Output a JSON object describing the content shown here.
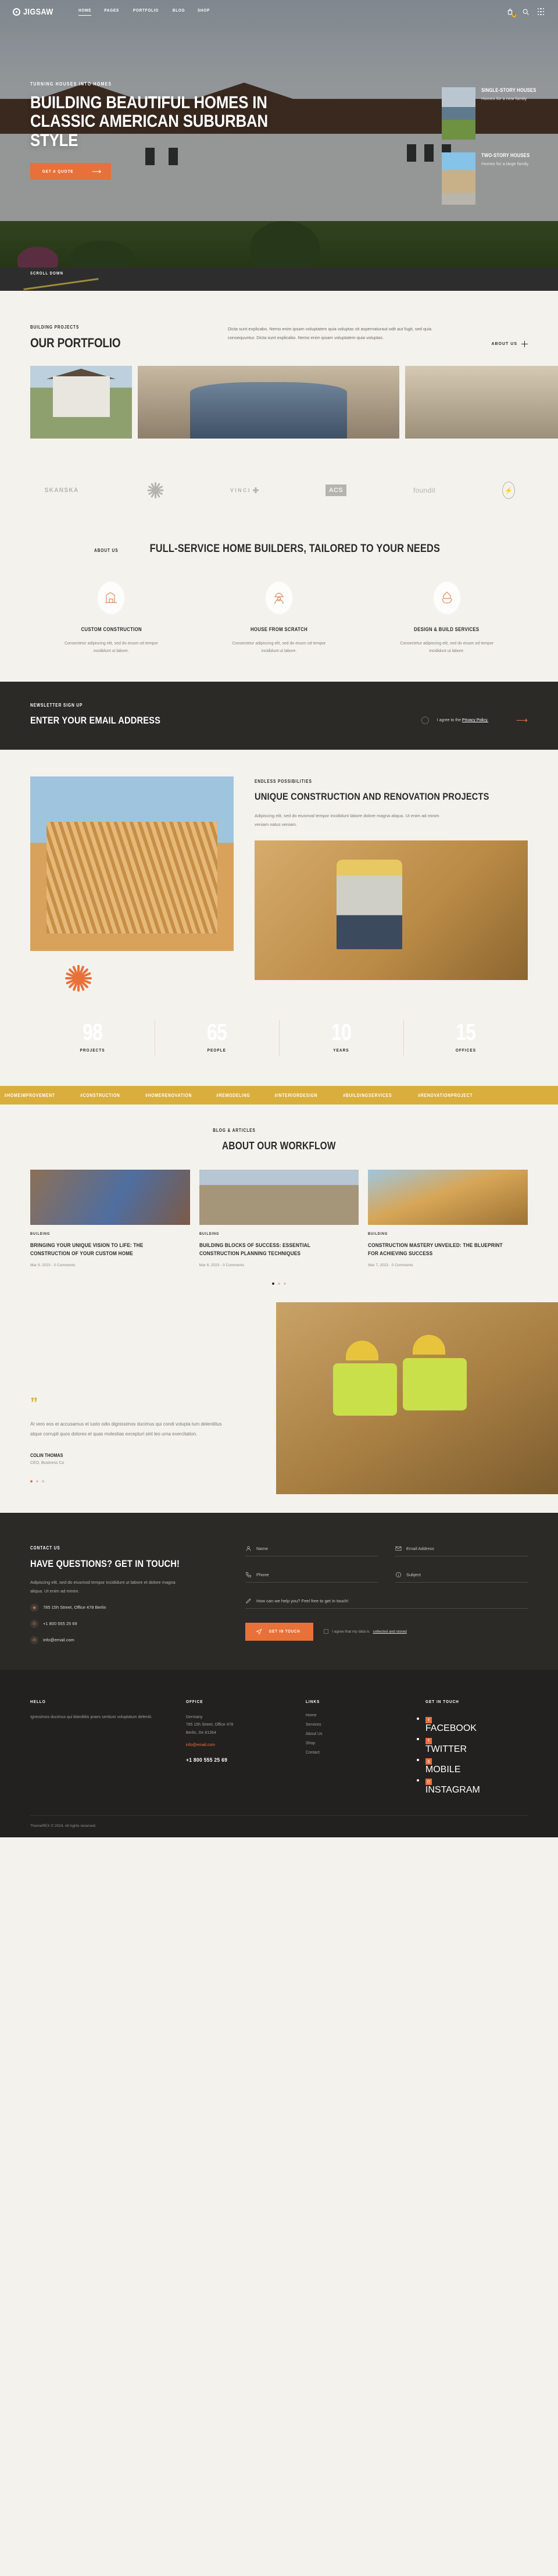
{
  "header": {
    "brand": "JIGSAW",
    "menu": [
      {
        "label": "HOME",
        "active": true
      },
      {
        "label": "PAGES",
        "active": false
      },
      {
        "label": "PORTFOLIO",
        "active": false
      },
      {
        "label": "BLOG",
        "active": false
      },
      {
        "label": "SHOP",
        "active": false
      }
    ],
    "cart_count": "0"
  },
  "hero": {
    "eyebrow": "TURNING HOUSES INTO HOMES",
    "title": "BUILDING BEAUTIFUL HOMES IN CLASSIC AMERICAN SUBURBAN STYLE",
    "cta": "GET A QUOTE",
    "scroll": "SCROLL DOWN",
    "cards": [
      {
        "title": "SINGLE-STORY HOUSES",
        "text": "Homes for a new family"
      },
      {
        "title": "TWO-STORY HOUSES",
        "text": "Homes for a large family"
      }
    ]
  },
  "portfolio": {
    "eyebrow": "BUILDING PROJECTS",
    "title": "OUR PORTFOLIO",
    "description": "Dicta sunt explicabo. Nemo enim ipsam voluptatem quia voluptas sit aspernaturaut odit aut fugit, sed quia consequuntur. Dicta sunt explicabo. Nemo enim ipsam voluptatem quia voluptas.",
    "link": "ABOUT US"
  },
  "logos": [
    {
      "name": "SKANSKA"
    },
    {
      "name": "flower-mark"
    },
    {
      "name": "VINCI"
    },
    {
      "name": "ACS"
    },
    {
      "name": "foundit"
    },
    {
      "name": "LT"
    }
  ],
  "about": {
    "eyebrow": "ABOUT US",
    "title": "FULL-SERVICE HOME BUILDERS, TAILORED TO YOUR NEEDS",
    "services": [
      {
        "icon": "blueprint-icon",
        "title": "CUSTOM CONSTRUCTION",
        "text": "Consectetur adipiscing elit, sed do eiusm od tempor incididunt ut labore."
      },
      {
        "icon": "worker-icon",
        "title": "HOUSE FROM SCRATCH",
        "text": "Consectetur adipiscing elit, sed do eiusm od tempor incididunt ut labore."
      },
      {
        "icon": "house-hands-icon",
        "title": "DESIGN & BUILD SERVICES",
        "text": "Consectetur adipiscing elit, sed do eiusm od tempor incididunt ut labore."
      }
    ]
  },
  "newsletter": {
    "eyebrow": "NEWSLETTER SIGN UP",
    "heading": "ENTER YOUR EMAIL ADDRESS",
    "placeholder": "ENTER YOUR EMAIL ADDRESS",
    "agree_prefix": "I agree to the ",
    "agree_link": "Privacy Policy.",
    "submit": "→"
  },
  "projects": {
    "eyebrow": "ENDLESS POSSIBILITIES",
    "title": "UNIQUE CONSTRUCTION AND RENOVATION PROJECTS",
    "body": "Adipiscing elit, sed do eiusmod tempor incididunt labore dolore magna aliqua. Ut enim ad minim veniam natus veniam."
  },
  "stats": [
    {
      "value": "98",
      "label": "PROJECTS"
    },
    {
      "value": "65",
      "label": "PEOPLE"
    },
    {
      "value": "10",
      "label": "YEARS"
    },
    {
      "value": "15",
      "label": "OFFICES"
    }
  ],
  "ticker": [
    "#HOMEIMPROVEMENT",
    "#CONSTRUCTION",
    "#HOMERENOVATION",
    "#REMODELING",
    "#INTERIORDESIGN",
    "#BUILDINGSERVICES",
    "#RENOVATIONPROJECT"
  ],
  "blog": {
    "eyebrow": "BLOG & ARTICLES",
    "title": "ABOUT OUR WORKFLOW",
    "posts": [
      {
        "category": "BUILDING",
        "title": "BRINGING YOUR UNIQUE VISION TO LIFE: THE CONSTRUCTION OF YOUR CUSTOM HOME",
        "meta": "Mar 9, 2023  ·  0 Comments"
      },
      {
        "category": "BUILDING",
        "title": "BUILDING BLOCKS OF SUCCESS: ESSENTIAL CONSTRUCTION PLANNING TECHNIQUES",
        "meta": "Mar 8, 2023  ·  0 Comments"
      },
      {
        "category": "BUILDING",
        "title": "CONSTRUCTION MASTERY UNVEILED: THE BLUEPRINT FOR ACHIEVING SUCCESS",
        "meta": "Mar 7, 2023  ·  0 Comments"
      }
    ]
  },
  "testimonial": {
    "quote": "At vero eos et accusamus et iusto odio dignissimos ducimus qui condi volupta tum delenititus atque corrupti quos dolores et quas molestias excepturi sint leo urna exercitation.",
    "author": "COLIN THOMAS",
    "role": "CEO, Business Co"
  },
  "contact": {
    "eyebrow": "CONTACT US",
    "title": "HAVE QUESTIONS? GET IN TOUCH!",
    "body": "Adipiscing elit, sed do eiusmod tempor incididunt ut labore et dolore magna aliqua. Ut enim ad minim.",
    "address": "785 15h Street, Office 478 Berlin",
    "phone": "+1 800 555 25 69",
    "email": "info@email.com",
    "fields": [
      {
        "icon": "user-icon",
        "label": "Name"
      },
      {
        "icon": "envelope-icon",
        "label": "Email Address"
      },
      {
        "icon": "phone-icon",
        "label": "Phone"
      },
      {
        "icon": "info-icon",
        "label": "Subject"
      }
    ],
    "message_label": "How can we help you? Feel free to get in touch!",
    "message_icon": "pencil-icon",
    "submit": "GET IN TOUCH",
    "consent_prefix": "I agree that my data is ",
    "consent_link": "collected and stored"
  },
  "footer": {
    "hello": {
      "heading": "HELLO",
      "text": "Ignissimos ducimus qui blanditiis praes sentium voluptatum deleniti."
    },
    "office": {
      "heading": "OFFICE",
      "line1": "Germany",
      "line2": "785 15h Street, Office 478",
      "line3": "Berlin, De 81364",
      "email": "info@email.com",
      "phone": "+1 800 555 25 69"
    },
    "links": {
      "heading": "LINKS",
      "items": [
        "Home",
        "Services",
        "About Us",
        "Shop",
        "Contact"
      ]
    },
    "social": {
      "heading": "GET IN TOUCH",
      "items": [
        "FACEBOOK",
        "TWITTER",
        "MOBILE",
        "INSTAGRAM"
      ]
    },
    "copyright": "ThemeREX © 2024. All rights reserved."
  }
}
